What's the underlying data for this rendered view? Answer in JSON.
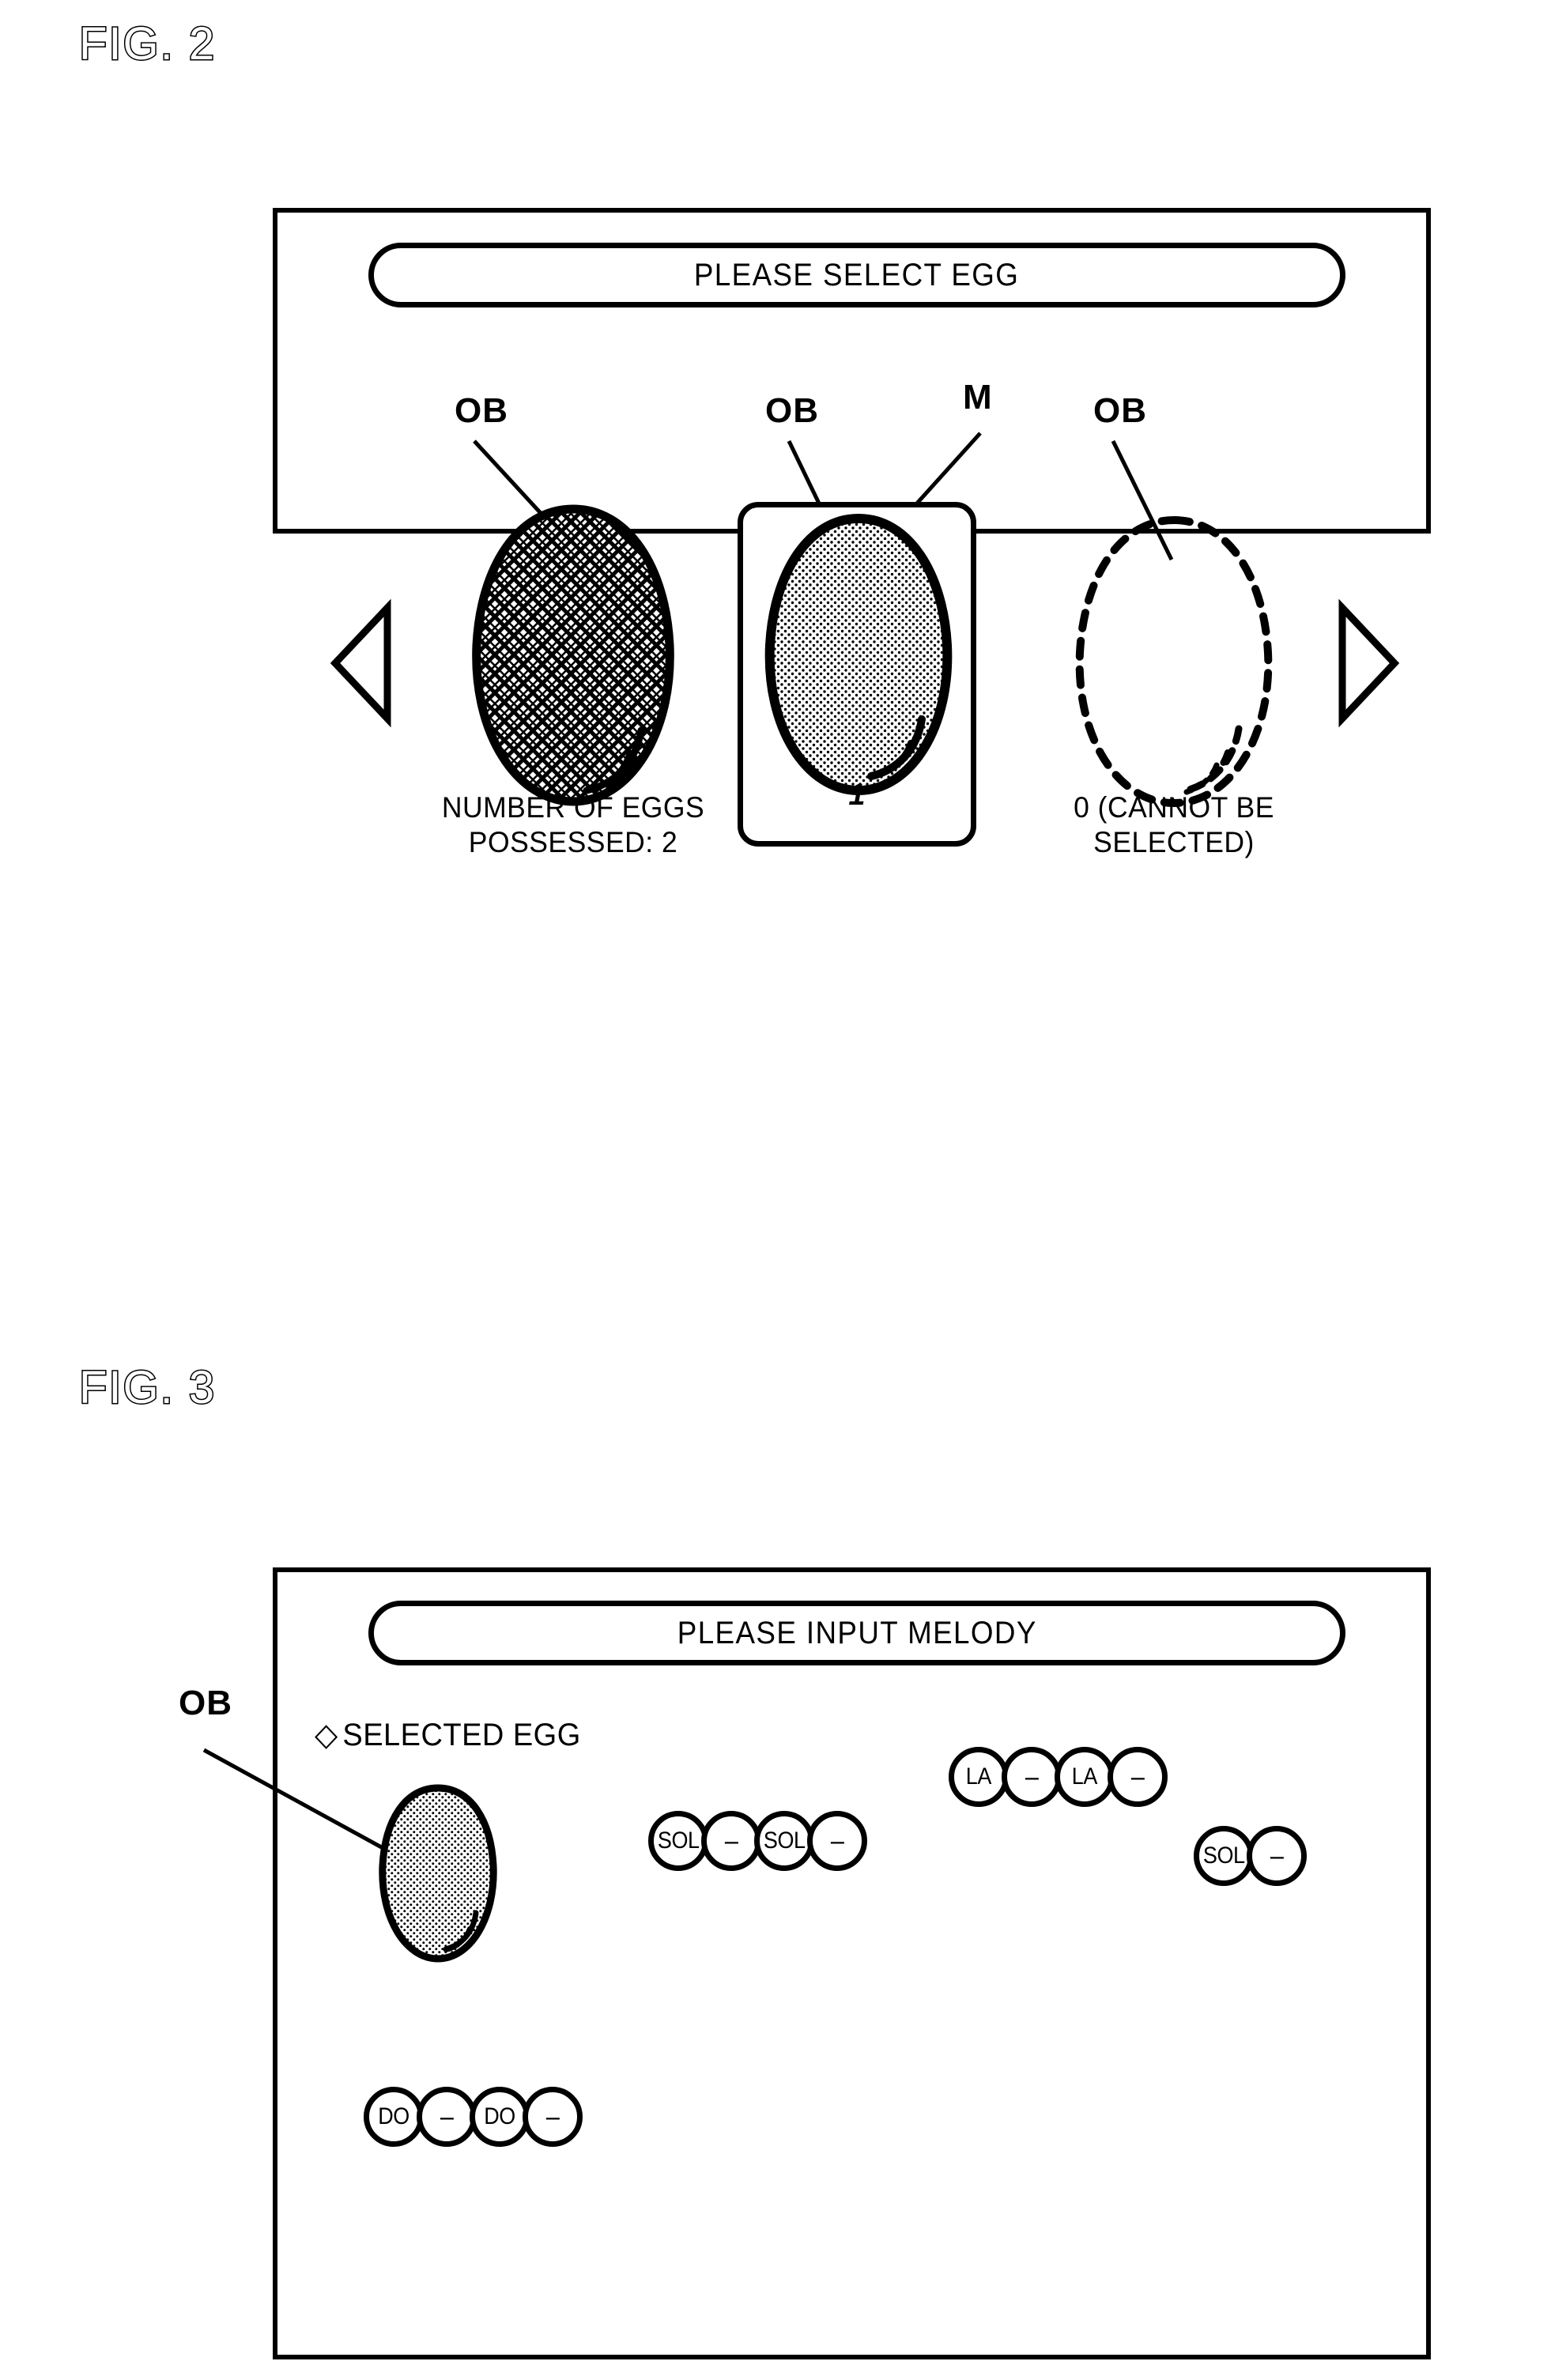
{
  "figures": [
    {
      "id": "fig2",
      "label": "FIG. 2",
      "banner": "PLEASE SELECT EGG",
      "eggs": [
        {
          "ref": "OB",
          "style": "crosshatch",
          "caption_line1": "NUMBER OF EGGS",
          "caption_line2": "POSSESSED: 2"
        },
        {
          "ref": "OB",
          "style": "stipple",
          "selected": true,
          "box_ref": "M",
          "count_label": "1"
        },
        {
          "ref": "OB",
          "style": "dashed",
          "caption_line1": "0 (CANNOT BE",
          "caption_line2": "SELECTED)"
        }
      ],
      "nav": {
        "prev": "left-arrow",
        "next": "right-arrow"
      }
    },
    {
      "id": "fig3",
      "label": "FIG. 3",
      "banner": "PLEASE INPUT MELODY",
      "egg_ref": "OB",
      "legend": {
        "bullet": "◇",
        "text": "SELECTED EGG"
      },
      "melody_groups": [
        {
          "name": "group-sol-1",
          "notes": [
            "SOL",
            "–",
            "SOL",
            "–"
          ]
        },
        {
          "name": "group-la",
          "notes": [
            "LA",
            "–",
            "LA",
            "–"
          ]
        },
        {
          "name": "group-sol-2",
          "notes": [
            "SOL",
            "–"
          ]
        },
        {
          "name": "group-do",
          "notes": [
            "DO",
            "–",
            "DO",
            "–"
          ]
        }
      ]
    }
  ],
  "colors": {
    "ink": "#000000",
    "paper": "#ffffff",
    "egg_fill_stipple": "#d8d8d8"
  }
}
